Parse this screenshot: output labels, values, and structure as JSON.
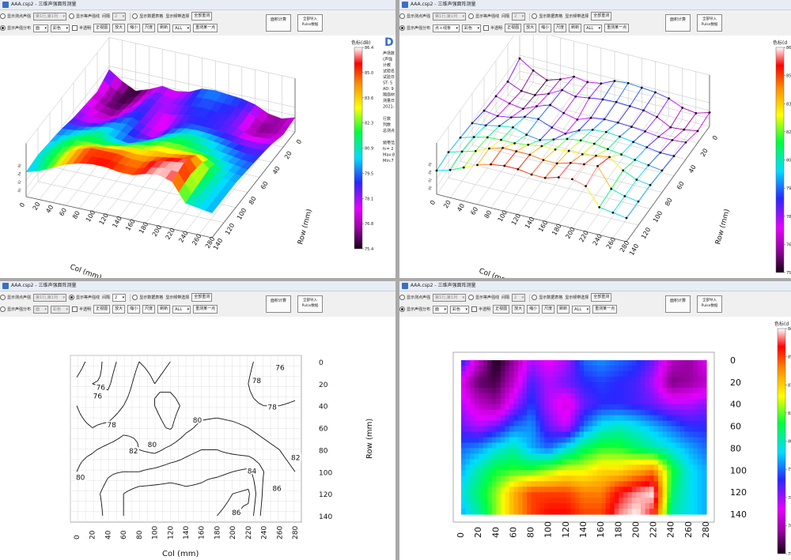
{
  "windows": [
    {
      "title": "AAA.csp2 - 三维声强面阵测量",
      "view": "surface3d",
      "tb": {
        "r1": [
          "显示测点声强",
          "第1行,第1列",
          "显示等声强线",
          "间隔",
          "2",
          "显示数据表格",
          "显示频带选择",
          "全部重测"
        ],
        "r2": [
          "显示声强分布",
          "面",
          "彩色",
          "半透明",
          "正视图",
          "放大",
          "缩小",
          "尺度",
          "刷新",
          "ALL",
          "重测某一点"
        ],
        "calc": "面积计算",
        "import": "全部导入\nPulse数据"
      }
    },
    {
      "title": "AAA.csp2 - 三维声强面阵测量",
      "view": "wire3d",
      "tb": {
        "r1": [
          "显示测点声强",
          "第1行,第1列",
          "显示等声强线",
          "间隔",
          "2",
          "显示数据表格",
          "显示频带选择",
          "全部重测"
        ],
        "r2": [
          "显示声强分布",
          "点＋线条",
          "彩色",
          "半透明",
          "正视图",
          "放大",
          "缩小",
          "尺度",
          "刷新",
          "ALL",
          "重测某一点"
        ],
        "calc": "面积计算",
        "import": "全部导入\nPulse数据"
      }
    },
    {
      "title": "AAA.csp2 - 三维声强面阵测量",
      "view": "contour",
      "tb": {
        "r1": [
          "显示测点声强",
          "第1行,第1列",
          "显示等声强线",
          "间隔",
          "2",
          "显示数据表格",
          "显示频带选择",
          "全部重测"
        ],
        "r2": [
          "显示声强分布",
          "面",
          "彩色",
          "半透明",
          "正视图",
          "放大",
          "缩小",
          "尺度",
          "刷新",
          "ALL",
          "重测某一点"
        ],
        "calc": "面积计算",
        "import": "全部导入\nPulse数据"
      }
    },
    {
      "title": "AAA.csp2 - 三维声强面阵测量",
      "view": "heatmap",
      "tb": {
        "r1": [
          "显示测点声强",
          "第1行,第1列",
          "显示等声强线",
          "间隔",
          "2",
          "显示数据表格",
          "显示频带选择",
          "全部重测"
        ],
        "r2": [
          "显示声强分布",
          "面",
          "彩色",
          "半透明",
          "正视图",
          "放大",
          "缩小",
          "尺度",
          "刷新",
          "ALL",
          "重测某一点"
        ],
        "calc": "面积计算",
        "import": "全部导入\nPulse数据"
      }
    }
  ],
  "info_panel": {
    "logo": "D",
    "lines": [
      "声场数",
      "(声强",
      "计教",
      "试验名",
      "试验日",
      "ST: 5",
      "AD: 9",
      "隔扇材",
      "测量日",
      "2021-",
      "行数",
      "列数",
      "总测点",
      "频带范",
      "fc= 2",
      "Max:8",
      "Min:7"
    ]
  },
  "colorbar": {
    "title": "色标(dB)",
    "title_short": "色标(d",
    "ticks": [
      "86.4",
      "85.0",
      "83.6",
      "82.3",
      "80.9",
      "79.5",
      "78.1",
      "76.8",
      "75.4"
    ],
    "ticks_short": [
      "86",
      "85",
      "83",
      "82",
      "80",
      "79",
      "78",
      "76",
      "75"
    ]
  },
  "chart_data": [
    {
      "type": "heatmap",
      "title": "",
      "xlabel": "Col (mm)",
      "ylabel": "Row (mm)",
      "x": [
        0,
        20,
        40,
        60,
        80,
        100,
        120,
        140,
        160,
        180,
        200,
        220,
        240,
        260,
        280
      ],
      "y": [
        0,
        20,
        40,
        60,
        80,
        100,
        120,
        140
      ],
      "z": [
        [
          79.2,
          77.0,
          75.4,
          76.5,
          78.0,
          77.5,
          78.0,
          79.5,
          79.8,
          79.5,
          79.2,
          78.5,
          77.0,
          76.5,
          77.5
        ],
        [
          77.5,
          76.0,
          75.8,
          77.0,
          78.8,
          78.0,
          78.5,
          79.0,
          79.2,
          79.0,
          78.8,
          78.0,
          76.2,
          76.5,
          77.0
        ],
        [
          78.0,
          77.0,
          76.5,
          78.0,
          79.2,
          78.0,
          77.2,
          78.5,
          79.0,
          79.0,
          78.8,
          78.5,
          78.0,
          78.0,
          78.3
        ],
        [
          78.5,
          78.0,
          78.5,
          79.5,
          79.8,
          78.5,
          77.8,
          79.5,
          80.5,
          80.8,
          80.5,
          80.0,
          79.5,
          79.0,
          79.0
        ],
        [
          79.5,
          79.8,
          80.5,
          81.0,
          80.0,
          79.5,
          80.5,
          81.5,
          82.0,
          82.0,
          81.5,
          81.0,
          80.5,
          80.0,
          79.5
        ],
        [
          80.0,
          81.0,
          81.8,
          82.0,
          82.0,
          82.5,
          83.0,
          83.0,
          83.5,
          83.5,
          84.0,
          84.5,
          82.0,
          80.5,
          80.0
        ],
        [
          80.5,
          81.5,
          82.5,
          84.0,
          85.0,
          85.0,
          85.0,
          84.5,
          84.5,
          85.5,
          86.0,
          86.4,
          81.5,
          80.5,
          80.0
        ],
        [
          80.0,
          81.0,
          82.5,
          84.0,
          85.0,
          85.5,
          85.5,
          85.0,
          85.0,
          86.0,
          86.4,
          85.5,
          81.0,
          80.5,
          80.0
        ]
      ],
      "zlim": [
        75.4,
        86.4
      ],
      "contour_labels": [
        "76",
        "78",
        "80",
        "82",
        "84",
        "86"
      ],
      "axis_tick_labels": [
        "0",
        "20",
        "40",
        "60",
        "80",
        "100",
        "120",
        "140",
        "160",
        "180",
        "200",
        "220",
        "240",
        "260",
        "280"
      ],
      "row_tick_labels": [
        "0",
        "20",
        "40",
        "60",
        "80",
        "100",
        "120",
        "140"
      ],
      "z_tick_labels_3d": [
        "80",
        "82",
        "84",
        "86"
      ]
    }
  ]
}
